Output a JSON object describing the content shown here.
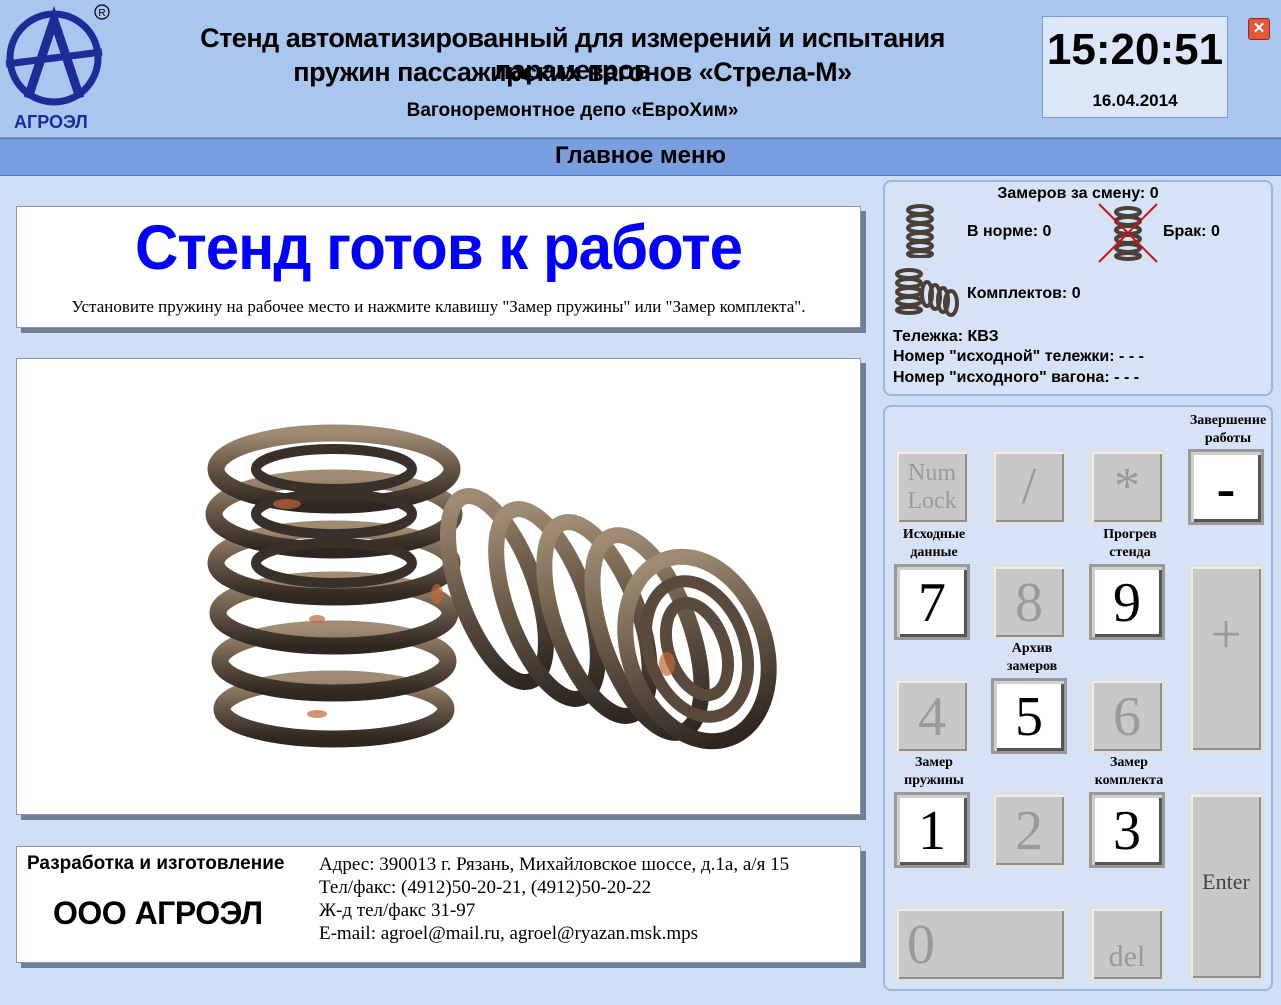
{
  "header": {
    "logo_text": "АГРОЭЛ",
    "title_line1": "Стенд автоматизированный для  измерений и испытания параметров",
    "title_line2": "пружин пассажирских вагонов «Стрела-М»",
    "subtitle": "Вагоноремонтное депо «ЕвроХим»",
    "time": "15:20:51",
    "date": "16.04.2014",
    "close_icon": "close-icon",
    "close_symbol": "✕"
  },
  "menu": {
    "title": "Главное меню"
  },
  "status": {
    "main": "Стенд готов к  работе",
    "hint": "Установите пружину на рабочее место и нажмите клавишу \"Замер пружины\" или \"Замер комплекта\"."
  },
  "stats": {
    "measurements": "Замеров за смену: 0",
    "normal": "В норме: 0",
    "defect": "Брак: 0",
    "sets": "Комплектов: 0",
    "bogie": "Тележка: КВЗ",
    "source_bogie": "Номер \"исходной\" тележки: - - -",
    "source_wagon": "Номер \"исходного\" вагона: - - -"
  },
  "keypad": {
    "finish_label": "Завершение работы",
    "source_data_label": "Исходные данные",
    "warmup_label": "Прогрев стенда",
    "archive_label": "Архив замеров",
    "spring_label": "Замер пружины",
    "set_label": "Замер комплекта",
    "keys": {
      "numlock": "Num Lock",
      "slash": "/",
      "star": "*",
      "minus": "-",
      "k7": "7",
      "k8": "8",
      "k9": "9",
      "plus": "+",
      "k4": "4",
      "k5": "5",
      "k6": "6",
      "k1": "1",
      "k2": "2",
      "k3": "3",
      "enter": "Enter",
      "k0": "0",
      "del": "del"
    }
  },
  "footer": {
    "dev_label": "Разработка и изготовление",
    "company": "ООО АГРОЭЛ",
    "address": "Адрес: 390013 г. Рязань, Михайловское шоссе, д.1а, а/я 15",
    "phone": "Тел/факс: (4912)50-20-21, (4912)50-20-22",
    "rail_phone": "Ж-д тел/факс 31-97",
    "email": "E-mail: agroel@mail.ru, agroel@ryazan.msk.mps"
  },
  "colors": {
    "header_bg": "#a9c6ef",
    "menu_bg": "#7a9fe0",
    "status_blue": "#0000ff",
    "logo_blue": "#1f2b96"
  }
}
